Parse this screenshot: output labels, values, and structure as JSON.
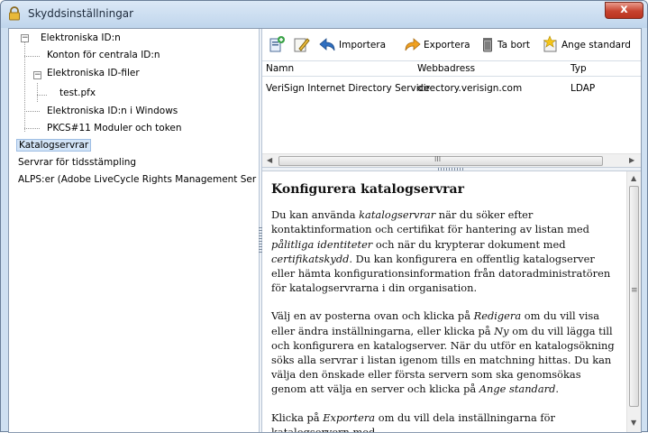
{
  "window": {
    "title": "Skyddsinställningar",
    "close_label": "x",
    "accent": "#c7432f"
  },
  "tree": {
    "items": [
      {
        "label": "Elektroniska ID:n",
        "expander": "−"
      },
      {
        "label": "Konton för centrala ID:n"
      },
      {
        "label": "Elektroniska ID-filer",
        "expander": "−"
      },
      {
        "label": "test.pfx"
      },
      {
        "label": "Elektroniska ID:n i Windows"
      },
      {
        "label": "PKCS#11 Moduler och token"
      },
      {
        "label": "Katalogservrar",
        "selected": true
      },
      {
        "label": "Servrar för tidsstämpling"
      },
      {
        "label": "ALPS:er (Adobe LiveCycle Rights Management Ser"
      }
    ]
  },
  "toolbar": {
    "new_icon": "new-document-icon",
    "edit_icon": "edit-pencil-icon",
    "import_label": "Importera",
    "export_label": "Exportera",
    "delete_label": "Ta bort",
    "default_label": "Ange standard"
  },
  "list": {
    "columns": [
      "Namn",
      "Webbadress",
      "Typ"
    ],
    "rows": [
      [
        "VeriSign Internet Directory Service",
        "directory.verisign.com",
        "LDAP"
      ]
    ]
  },
  "scroll": {
    "h_mid": "III",
    "v_mid": "≡"
  },
  "help": {
    "title": "Konfigurera katalogservrar",
    "p1": {
      "a": "Du kan använda ",
      "b": "katalogservrar",
      "c": " när du söker efter kontaktinformation och certifikat för hantering av listan med ",
      "d": "pålitliga identiteter",
      "e": " och när du krypterar dokument med ",
      "f": "certifikatskydd",
      "g": ". Du kan konfigurera en offentlig katalogserver eller hämta konfigurationsinformation från datoradministratören för katalogservrarna i din organisation."
    },
    "p2": {
      "a": "Välj en av posterna ovan och klicka på ",
      "b": "Redigera",
      "c": " om du vill visa eller ändra inställningarna, eller klicka på ",
      "d": "Ny",
      "e": " om du vill lägga till och konfigurera en katalogserver. När du utför en katalogsökning söks alla servrar i listan igenom tills en matchning hittas. Du kan välja den önskade eller första servern som ska genomsökas genom att välja en server och klicka på ",
      "f": "Ange standard",
      "g": "."
    },
    "p3": {
      "a": "Klicka på ",
      "b": "Exportera",
      "c": " om du vill dela inställningarna för katalogservern med"
    }
  }
}
